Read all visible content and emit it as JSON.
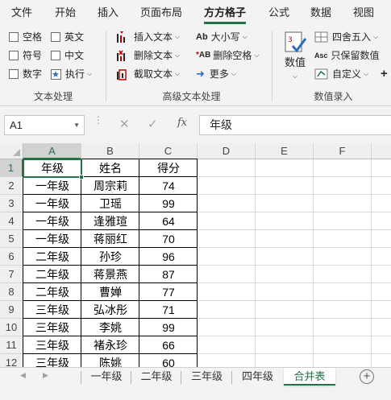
{
  "menu": {
    "tabs": [
      {
        "label": "文件",
        "active": false
      },
      {
        "label": "开始",
        "active": false
      },
      {
        "label": "插入",
        "active": false
      },
      {
        "label": "页面布局",
        "active": false
      },
      {
        "label": "方方格子",
        "active": true
      },
      {
        "label": "公式",
        "active": false
      },
      {
        "label": "数据",
        "active": false
      },
      {
        "label": "视图",
        "active": false
      }
    ]
  },
  "ribbon": {
    "text_group": {
      "label": "文本处理",
      "options": [
        "空格",
        "英文",
        "符号",
        "中文",
        "数字",
        "执行"
      ]
    },
    "advanced_group": {
      "label": "高级文本处理",
      "insert_text": "插入文本",
      "delete_text": "删除文本",
      "extract_text": "截取文本",
      "case": "大小写",
      "delete_space": "删除空格",
      "more": "更多"
    },
    "number_group": {
      "label": "数值录入",
      "numeric": "数值",
      "round": "四舍五入",
      "keep_value": "只保留数值",
      "custom": "自定义"
    }
  },
  "formula_bar": {
    "name_box": "A1",
    "value": "年级"
  },
  "columns": [
    "A",
    "B",
    "C",
    "D",
    "E",
    "F"
  ],
  "rows": [
    "1",
    "2",
    "3",
    "4",
    "5",
    "6",
    "7",
    "8",
    "9",
    "10",
    "11",
    "12"
  ],
  "table": [
    [
      "年级",
      "姓名",
      "得分"
    ],
    [
      "一年级",
      "周宗莉",
      "74"
    ],
    [
      "一年级",
      "卫瑶",
      "99"
    ],
    [
      "一年级",
      "逢雅瑄",
      "64"
    ],
    [
      "一年级",
      "蒋丽红",
      "70"
    ],
    [
      "二年级",
      "孙珍",
      "96"
    ],
    [
      "二年级",
      "蒋景燕",
      "87"
    ],
    [
      "二年级",
      "曹婵",
      "77"
    ],
    [
      "三年级",
      "弘冰彤",
      "71"
    ],
    [
      "三年级",
      "李姚",
      "99"
    ],
    [
      "三年级",
      "褚永珍",
      "66"
    ],
    [
      "三年级",
      "陈姚",
      "60"
    ]
  ],
  "sheets": [
    {
      "label": "一年级",
      "active": false
    },
    {
      "label": "二年级",
      "active": false
    },
    {
      "label": "三年级",
      "active": false
    },
    {
      "label": "四年级",
      "active": false
    },
    {
      "label": "合并表",
      "active": true
    }
  ],
  "add_sheet_symbol": "+",
  "colors": {
    "accent": "#217346",
    "ribbon_bg": "#f3f3f3",
    "icon_red": "#c00000",
    "icon_blue": "#2b6cc4"
  },
  "icons": {
    "expand_ribbon": "plus-icon",
    "name_box_dropdown": "chevron-down-icon",
    "cancel": "cross-icon",
    "confirm": "check-icon",
    "function": "fx-icon",
    "add_sheet": "plus-circle-icon"
  }
}
